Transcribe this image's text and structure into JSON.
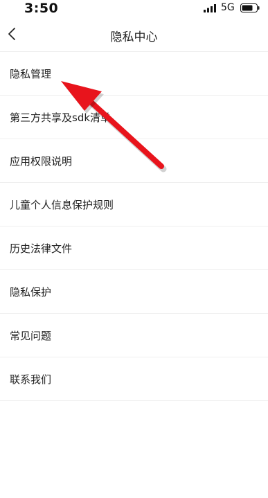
{
  "status_bar": {
    "time": "3:50",
    "network": "5G",
    "signal_icon": "signal-bars-icon",
    "battery_icon": "battery-icon"
  },
  "nav": {
    "title": "隐私中心",
    "back_icon": "chevron-left-icon"
  },
  "menu": {
    "items": [
      {
        "label": "隐私管理"
      },
      {
        "label": "第三方共享及sdk清单"
      },
      {
        "label": "应用权限说明"
      },
      {
        "label": "儿童个人信息保护规则"
      },
      {
        "label": "历史法律文件"
      },
      {
        "label": "隐私保护"
      },
      {
        "label": "常见问题"
      },
      {
        "label": "联系我们"
      }
    ]
  },
  "annotation": {
    "arrow_color": "#e8141c",
    "arrow_icon": "red-arrow-annotation"
  }
}
